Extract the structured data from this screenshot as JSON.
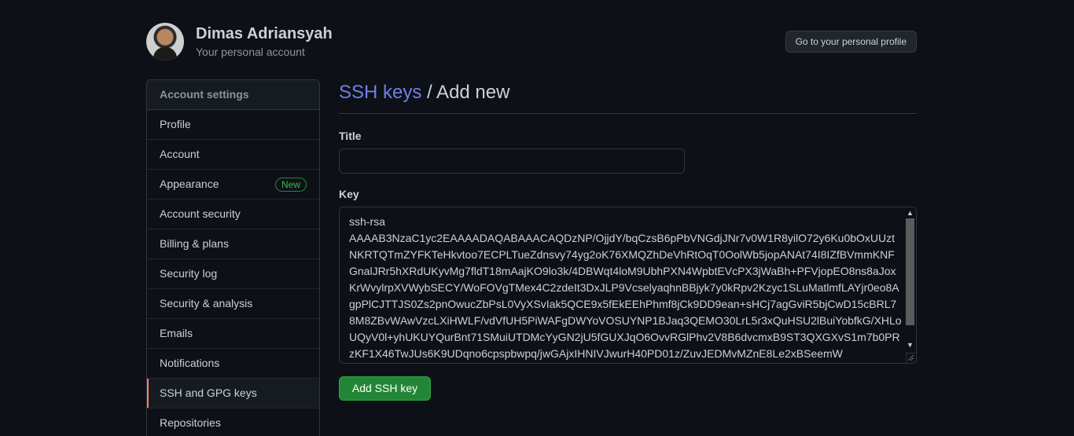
{
  "user": {
    "name": "Dimas Adriansyah",
    "subtitle": "Your personal account",
    "profile_button": "Go to your personal profile"
  },
  "sidebar": {
    "heading": "Account settings",
    "items": [
      {
        "label": "Profile"
      },
      {
        "label": "Account"
      },
      {
        "label": "Appearance",
        "badge": "New"
      },
      {
        "label": "Account security"
      },
      {
        "label": "Billing & plans"
      },
      {
        "label": "Security log"
      },
      {
        "label": "Security & analysis"
      },
      {
        "label": "Emails"
      },
      {
        "label": "Notifications"
      },
      {
        "label": "SSH and GPG keys",
        "selected": true
      },
      {
        "label": "Repositories"
      }
    ]
  },
  "main": {
    "breadcrumb_link": "SSH keys",
    "breadcrumb_rest": " / Add new",
    "title_label": "Title",
    "title_value": "",
    "key_label": "Key",
    "key_value": "ssh-rsa\nAAAAB3NzaC1yc2EAAAADAQABAAACAQDzNP/OjjdY/bqCzsB6pPbVNGdjJNr7v0W1R8yilO72y6Ku0bOxUUztNKRTQTmZYFKTeHkvtoo7ECPLTueZdnsvy74yg2oK76XMQZhDeVhRtOqT0OolWb5jopANAt74I8IZfBVmmKNFGnalJRr5hXRdUKyvMg7fldT18mAajKO9lo3k/4DBWqt4loM9UbhPXN4WpbtEVcPX3jWaBh+PFVjopEO8ns8aJoxKrWvylrpXVWybSECY/WoFOVgTMex4C2zdeIt3DxJLP9VcselyaqhnBBjyk7y0kRpv2Kzyc1SLuMatlmfLAYjr0eo8AgpPlCJTTJS0Zs2pnOwucZbPsL0VyXSvIak5QCE9x5fEkEEhPhmf8jCk9DD9ean+sHCj7agGviR5bjCwD15cBRL78M8ZBvWAwVzcLXiHWLF/vdVfUH5PiWAFgDWYoVOSUYNP1BJaq3QEMO30LrL5r3xQuHSU2lBuiYobfkG/XHLoUQyV0l+yhUKUYQurBnt71SMuiUTDMcYyGN2jU5fGUXJqO6OvvRGlPhv2V8B6dvcmxB9ST3QXGXvS1m7b0PRzKF1X46TwJUs6K9UDqno6cpspbwpq/jwGAjxIHNIVJwurH40PD01z/ZuvJEDMvMZnE8Le2xBSeemW",
    "submit_label": "Add SSH key"
  },
  "colors": {
    "background": "#0d1117",
    "link": "#6f7fe6",
    "button_green": "#238636",
    "badge_green": "#3fb950",
    "selected_marker": "#f78166"
  }
}
